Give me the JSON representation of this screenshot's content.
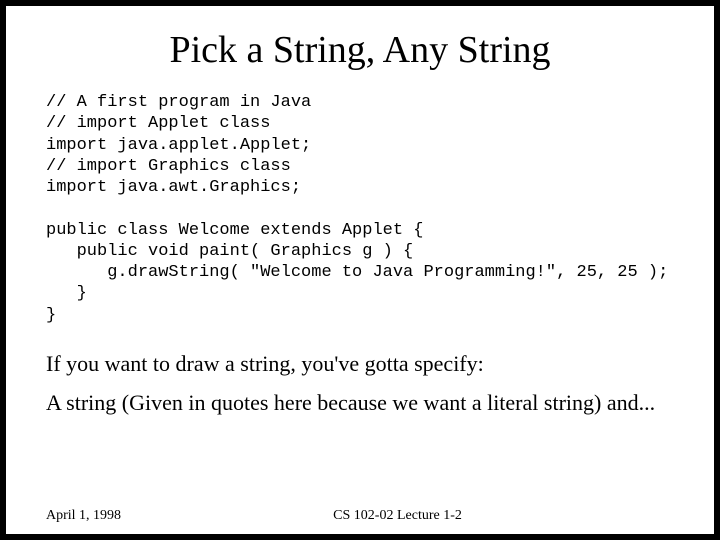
{
  "title": "Pick a String, Any String",
  "code": {
    "l1": "// A first program in Java",
    "l2": "// import Applet class",
    "l3": "import java.applet.Applet;",
    "l4": "// import Graphics class",
    "l5": "import java.awt.Graphics;",
    "l6": "public class Welcome extends Applet {",
    "l7": "   public void paint( Graphics g ) {",
    "l8": "      g.drawString( \"Welcome to Java Programming!\", 25, 25 );",
    "l9": "   }",
    "l10": "}"
  },
  "body": {
    "p1": "If you want to draw a string, you've gotta specify:",
    "p2": "A string (Given in quotes here because we want a literal string) and..."
  },
  "footer": {
    "date": "April 1, 1998",
    "center": "CS 102-02    Lecture 1-2"
  }
}
